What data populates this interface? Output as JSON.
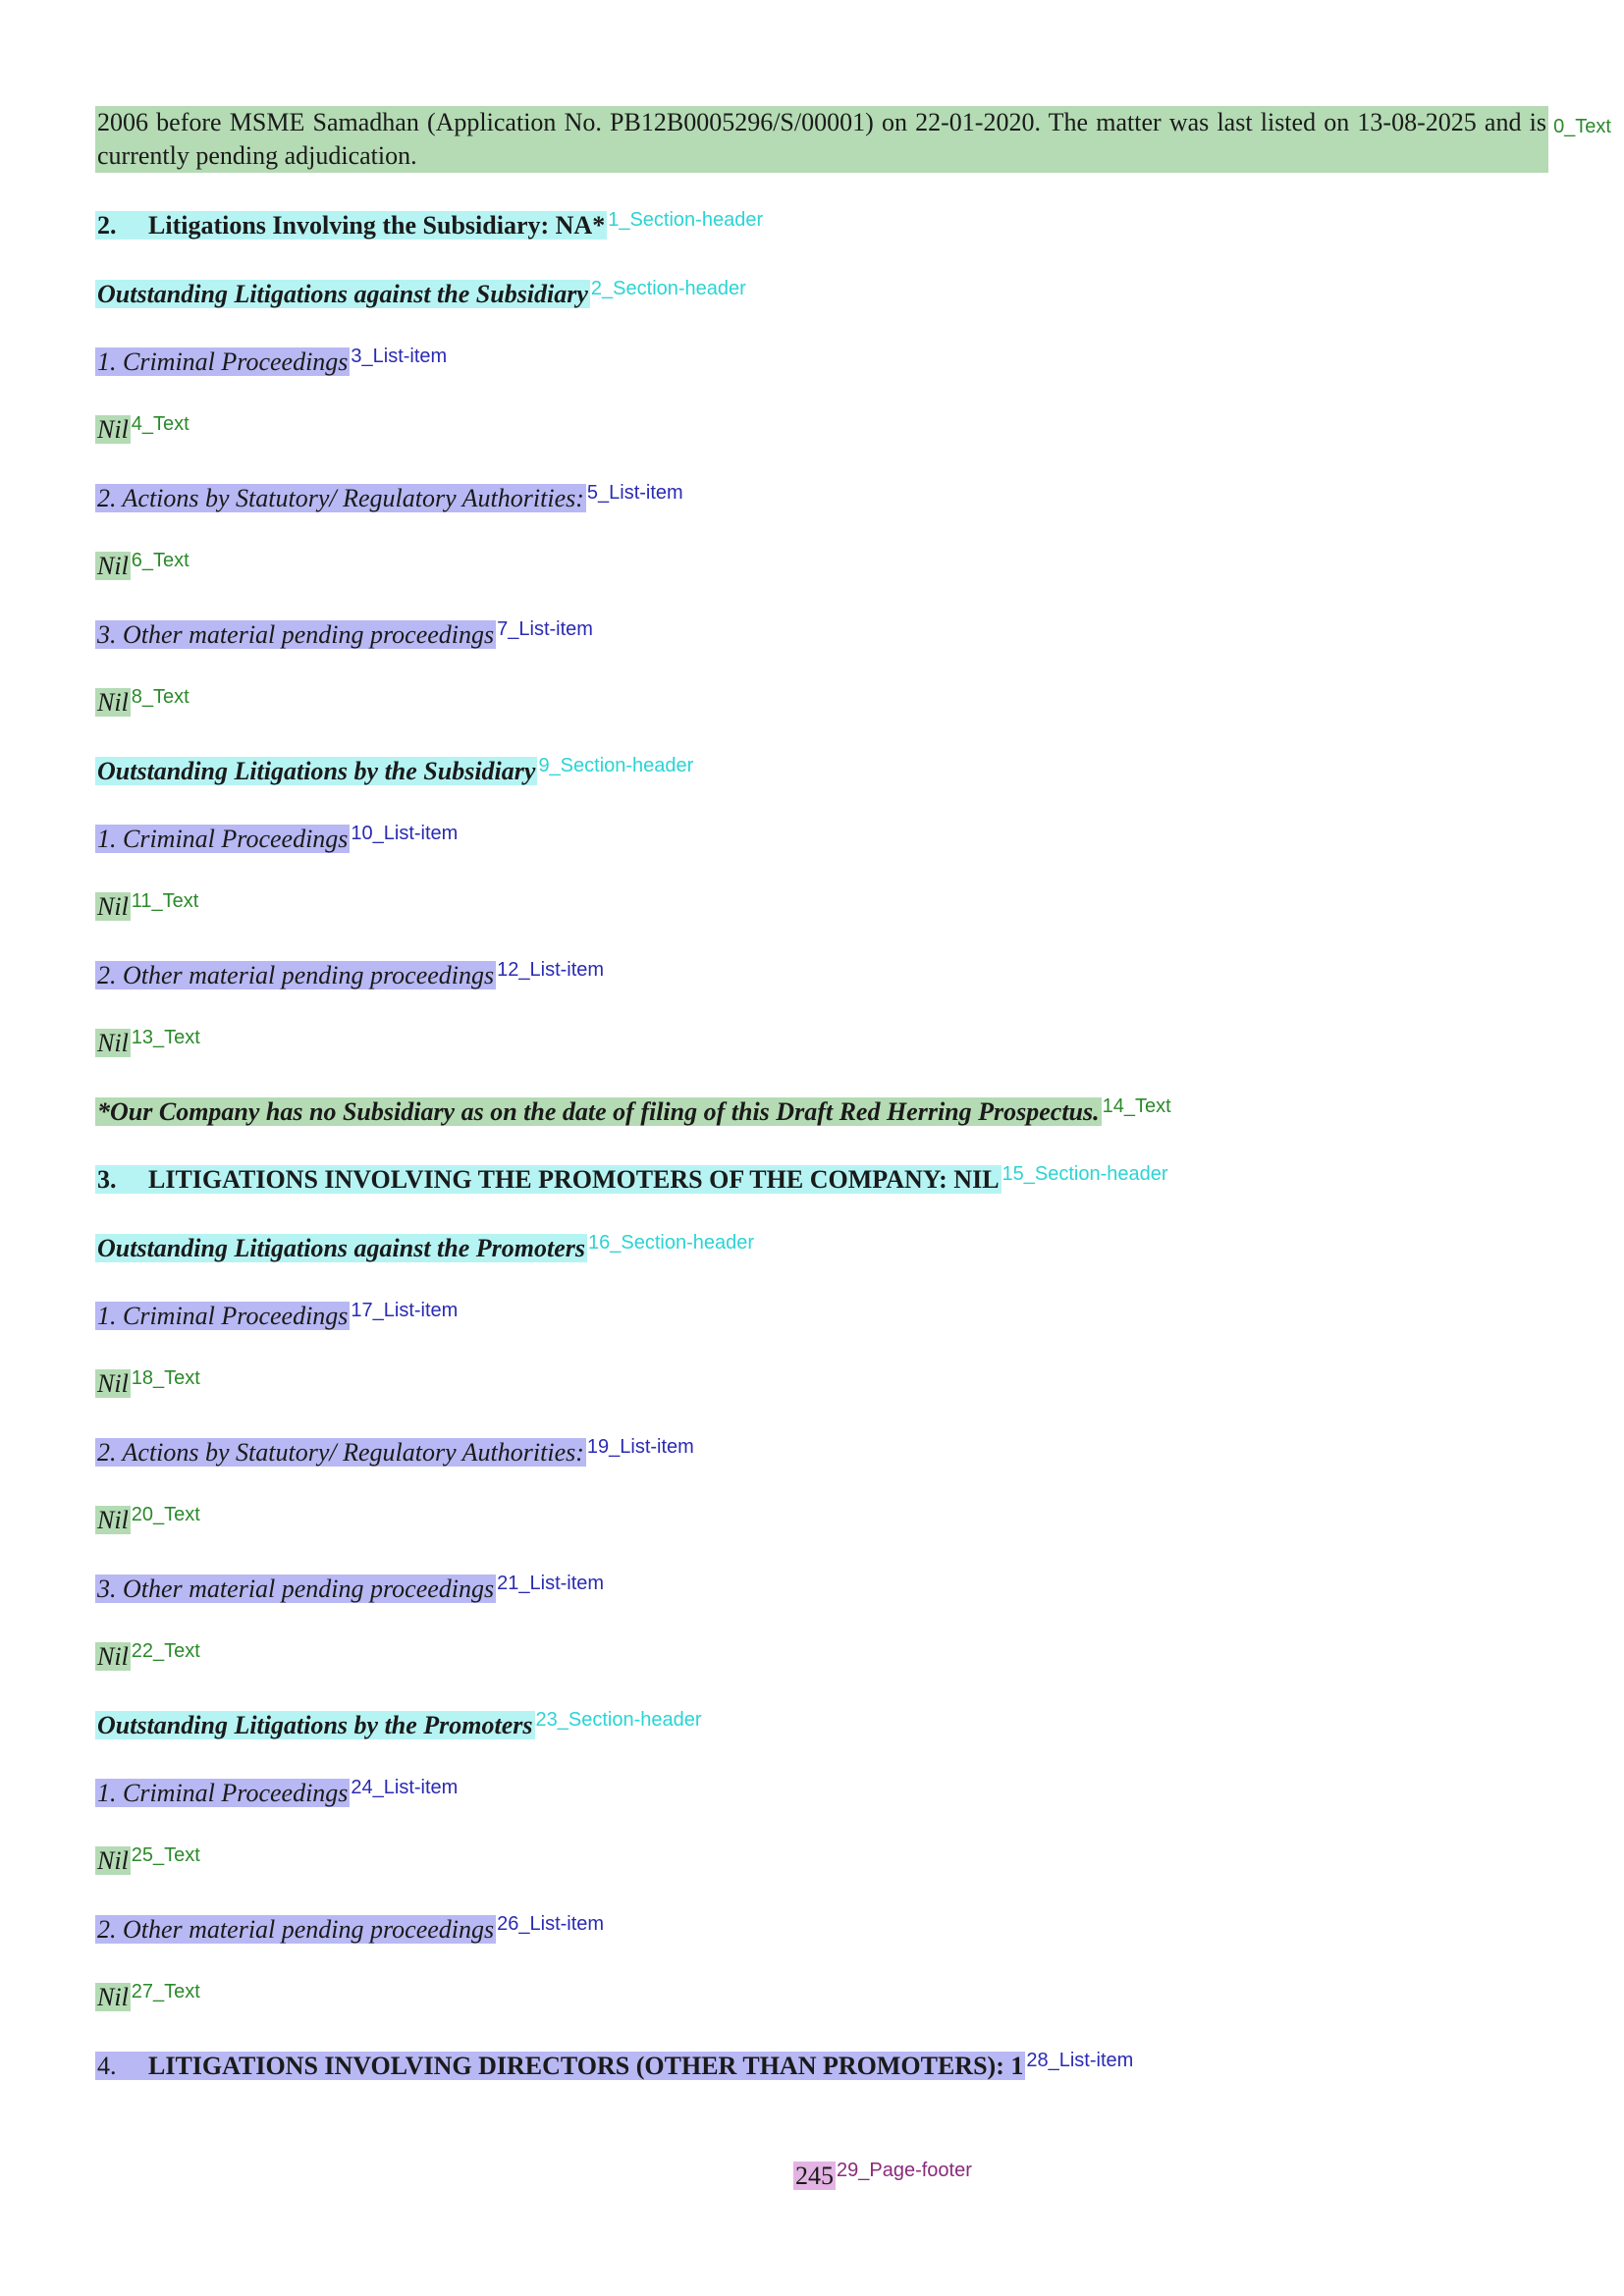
{
  "blocks": [
    {
      "text": "2006 before MSME Samadhan (Application No. PB12B0005296/S/00001) on 22-01-2020. The matter was last listed on 13-08-2025 and is currently pending adjudication.",
      "tag": "0_Text"
    },
    {
      "num": "2.",
      "text": "Litigations Involving the Subsidiary: NA*",
      "tag": "1_Section-header"
    },
    {
      "text": "Outstanding Litigations against the Subsidiary",
      "tag": "2_Section-header"
    },
    {
      "text": "1. Criminal Proceedings",
      "tag": "3_List-item"
    },
    {
      "text": "Nil",
      "tag": "4_Text"
    },
    {
      "text": "2. Actions by Statutory/ Regulatory Authorities:",
      "tag": "5_List-item"
    },
    {
      "text": "Nil",
      "tag": "6_Text"
    },
    {
      "text": "3. Other material pending proceedings",
      "tag": "7_List-item"
    },
    {
      "text": "Nil",
      "tag": "8_Text"
    },
    {
      "text": "Outstanding Litigations by the Subsidiary",
      "tag": "9_Section-header"
    },
    {
      "text": "1. Criminal Proceedings",
      "tag": "10_List-item"
    },
    {
      "text": "Nil",
      "tag": "11_Text"
    },
    {
      "text": "2. Other material pending proceedings",
      "tag": "12_List-item"
    },
    {
      "text": "Nil",
      "tag": "13_Text"
    },
    {
      "text": "*Our Company has no Subsidiary as on the date of filing of this Draft Red Herring Prospectus.",
      "tag": "14_Text"
    },
    {
      "num": "3.",
      "text": "LITIGATIONS INVOLVING THE PROMOTERS OF THE COMPANY: NIL",
      "tag": "15_Section-header"
    },
    {
      "text": "Outstanding Litigations against the Promoters",
      "tag": "16_Section-header"
    },
    {
      "text": "1. Criminal Proceedings",
      "tag": "17_List-item"
    },
    {
      "text": "Nil",
      "tag": "18_Text"
    },
    {
      "text": "2. Actions by Statutory/ Regulatory Authorities:",
      "tag": "19_List-item"
    },
    {
      "text": "Nil",
      "tag": "20_Text"
    },
    {
      "text": "3. Other material pending proceedings",
      "tag": "21_List-item"
    },
    {
      "text": "Nil",
      "tag": "22_Text"
    },
    {
      "text": "Outstanding Litigations by the Promoters",
      "tag": "23_Section-header"
    },
    {
      "text": "1. Criminal Proceedings",
      "tag": "24_List-item"
    },
    {
      "text": "Nil",
      "tag": "25_Text"
    },
    {
      "text": "2. Other material pending proceedings",
      "tag": "26_List-item"
    },
    {
      "text": "Nil",
      "tag": "27_Text"
    },
    {
      "num": "4.",
      "text": "LITIGATIONS INVOLVING DIRECTORS (OTHER THAN PROMOTERS): 1",
      "tag": "28_List-item"
    }
  ],
  "footer": {
    "page_number": "245",
    "tag": "29_Page-footer"
  }
}
